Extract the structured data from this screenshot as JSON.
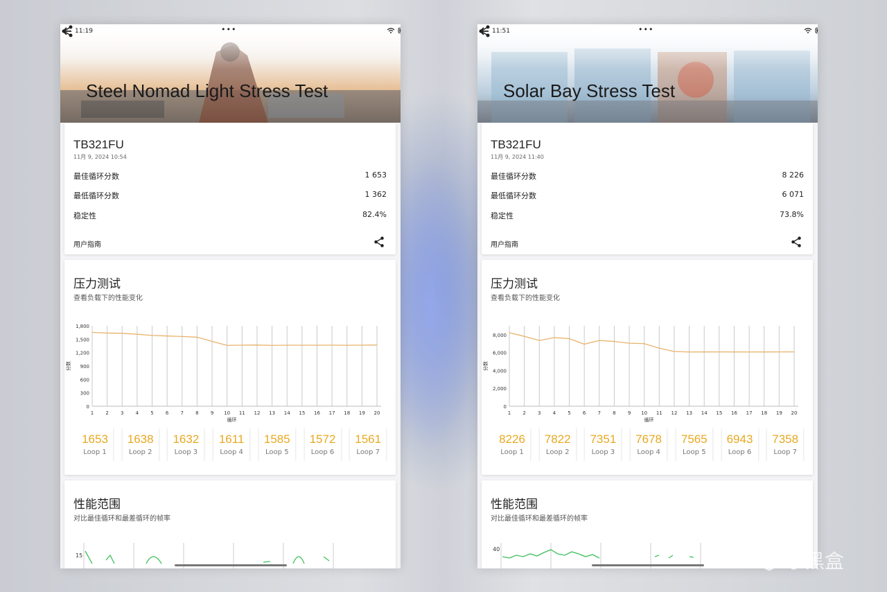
{
  "screens": [
    {
      "status_time": "11:19",
      "status_dots": "•••",
      "hero_title": "Steel Nomad Light Stress Test",
      "device": "TB321FU",
      "date": "11月 9, 2024 10:54",
      "rows": [
        {
          "label": "最佳循环分数",
          "value": "1 653"
        },
        {
          "label": "最低循环分数",
          "value": "1 362"
        },
        {
          "label": "稳定性",
          "value": "82.4%"
        }
      ],
      "guide": "用户指南",
      "stress_title": "压力测试",
      "stress_subtitle": "查看负载下的性能变化",
      "perf_title": "性能范围",
      "perf_subtitle": "对比最佳循环和最差循环的帧率",
      "perf_ytick": "15",
      "loops": [
        {
          "value": "1653",
          "label": "Loop 1"
        },
        {
          "value": "1638",
          "label": "Loop 2"
        },
        {
          "value": "1632",
          "label": "Loop 3"
        },
        {
          "value": "1611",
          "label": "Loop 4"
        },
        {
          "value": "1585",
          "label": "Loop 5"
        },
        {
          "value": "1572",
          "label": "Loop 6"
        },
        {
          "value": "1561",
          "label": "Loop 7"
        }
      ],
      "chart_data": {
        "type": "line",
        "x": [
          1,
          2,
          3,
          4,
          5,
          6,
          7,
          8,
          9,
          10,
          11,
          12,
          13,
          14,
          15,
          16,
          17,
          18,
          19,
          20
        ],
        "values": [
          1653,
          1638,
          1632,
          1611,
          1585,
          1572,
          1561,
          1545,
          1450,
          1362,
          1368,
          1370,
          1362,
          1365,
          1366,
          1366,
          1368,
          1364,
          1368,
          1370
        ],
        "yticks": [
          "0",
          "300",
          "600",
          "900",
          "1,200",
          "1,500",
          "1,800"
        ],
        "ylim": [
          0,
          1800
        ],
        "xlabel": "循环",
        "ylabel": "分数",
        "color": "#e8b26a"
      }
    },
    {
      "status_time": "11:51",
      "status_dots": "•••",
      "hero_title": "Solar Bay Stress Test",
      "device": "TB321FU",
      "date": "11月 9, 2024 11:40",
      "rows": [
        {
          "label": "最佳循环分数",
          "value": "8 226"
        },
        {
          "label": "最低循环分数",
          "value": "6 071"
        },
        {
          "label": "稳定性",
          "value": "73.8%"
        }
      ],
      "guide": "用户指南",
      "stress_title": "压力测试",
      "stress_subtitle": "查看负载下的性能变化",
      "perf_title": "性能范围",
      "perf_subtitle": "对比最佳循环和最差循环的帧率",
      "perf_ytick": "40",
      "loops": [
        {
          "value": "8226",
          "label": "Loop 1"
        },
        {
          "value": "7822",
          "label": "Loop 2"
        },
        {
          "value": "7351",
          "label": "Loop 3"
        },
        {
          "value": "7678",
          "label": "Loop 4"
        },
        {
          "value": "7565",
          "label": "Loop 5"
        },
        {
          "value": "6943",
          "label": "Loop 6"
        },
        {
          "value": "7358",
          "label": "Loop 7"
        }
      ],
      "chart_data": {
        "type": "line",
        "x": [
          1,
          2,
          3,
          4,
          5,
          6,
          7,
          8,
          9,
          10,
          11,
          12,
          13,
          14,
          15,
          16,
          17,
          18,
          19,
          20
        ],
        "values": [
          8226,
          7822,
          7351,
          7678,
          7565,
          6943,
          7358,
          7250,
          7050,
          7000,
          6500,
          6120,
          6071,
          6075,
          6080,
          6075,
          6070,
          6075,
          6080,
          6078
        ],
        "yticks": [
          "0",
          "2,000",
          "4,000",
          "6,000",
          "8,000"
        ],
        "ylim": [
          0,
          9000
        ],
        "xlabel": "循环",
        "ylabel": "分数",
        "color": "#e8b26a"
      }
    }
  ],
  "watermark": "小黑盒"
}
